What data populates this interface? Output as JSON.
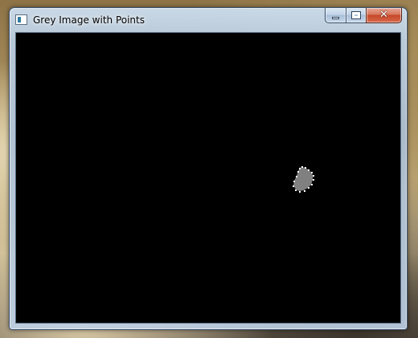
{
  "window": {
    "title": "Grey Image with Points",
    "icon": "app-window-icon"
  },
  "caption_buttons": {
    "minimize_icon": "minimize-icon",
    "maximize_icon": "maximize-icon",
    "close_glyph": "✕"
  },
  "canvas": {
    "background_color": "#000000",
    "blob_color": "#808080",
    "point_color": "#ffffff"
  },
  "colors": {
    "titlebar_glass": "#bcd3ea",
    "close_red": "#c6482a"
  }
}
